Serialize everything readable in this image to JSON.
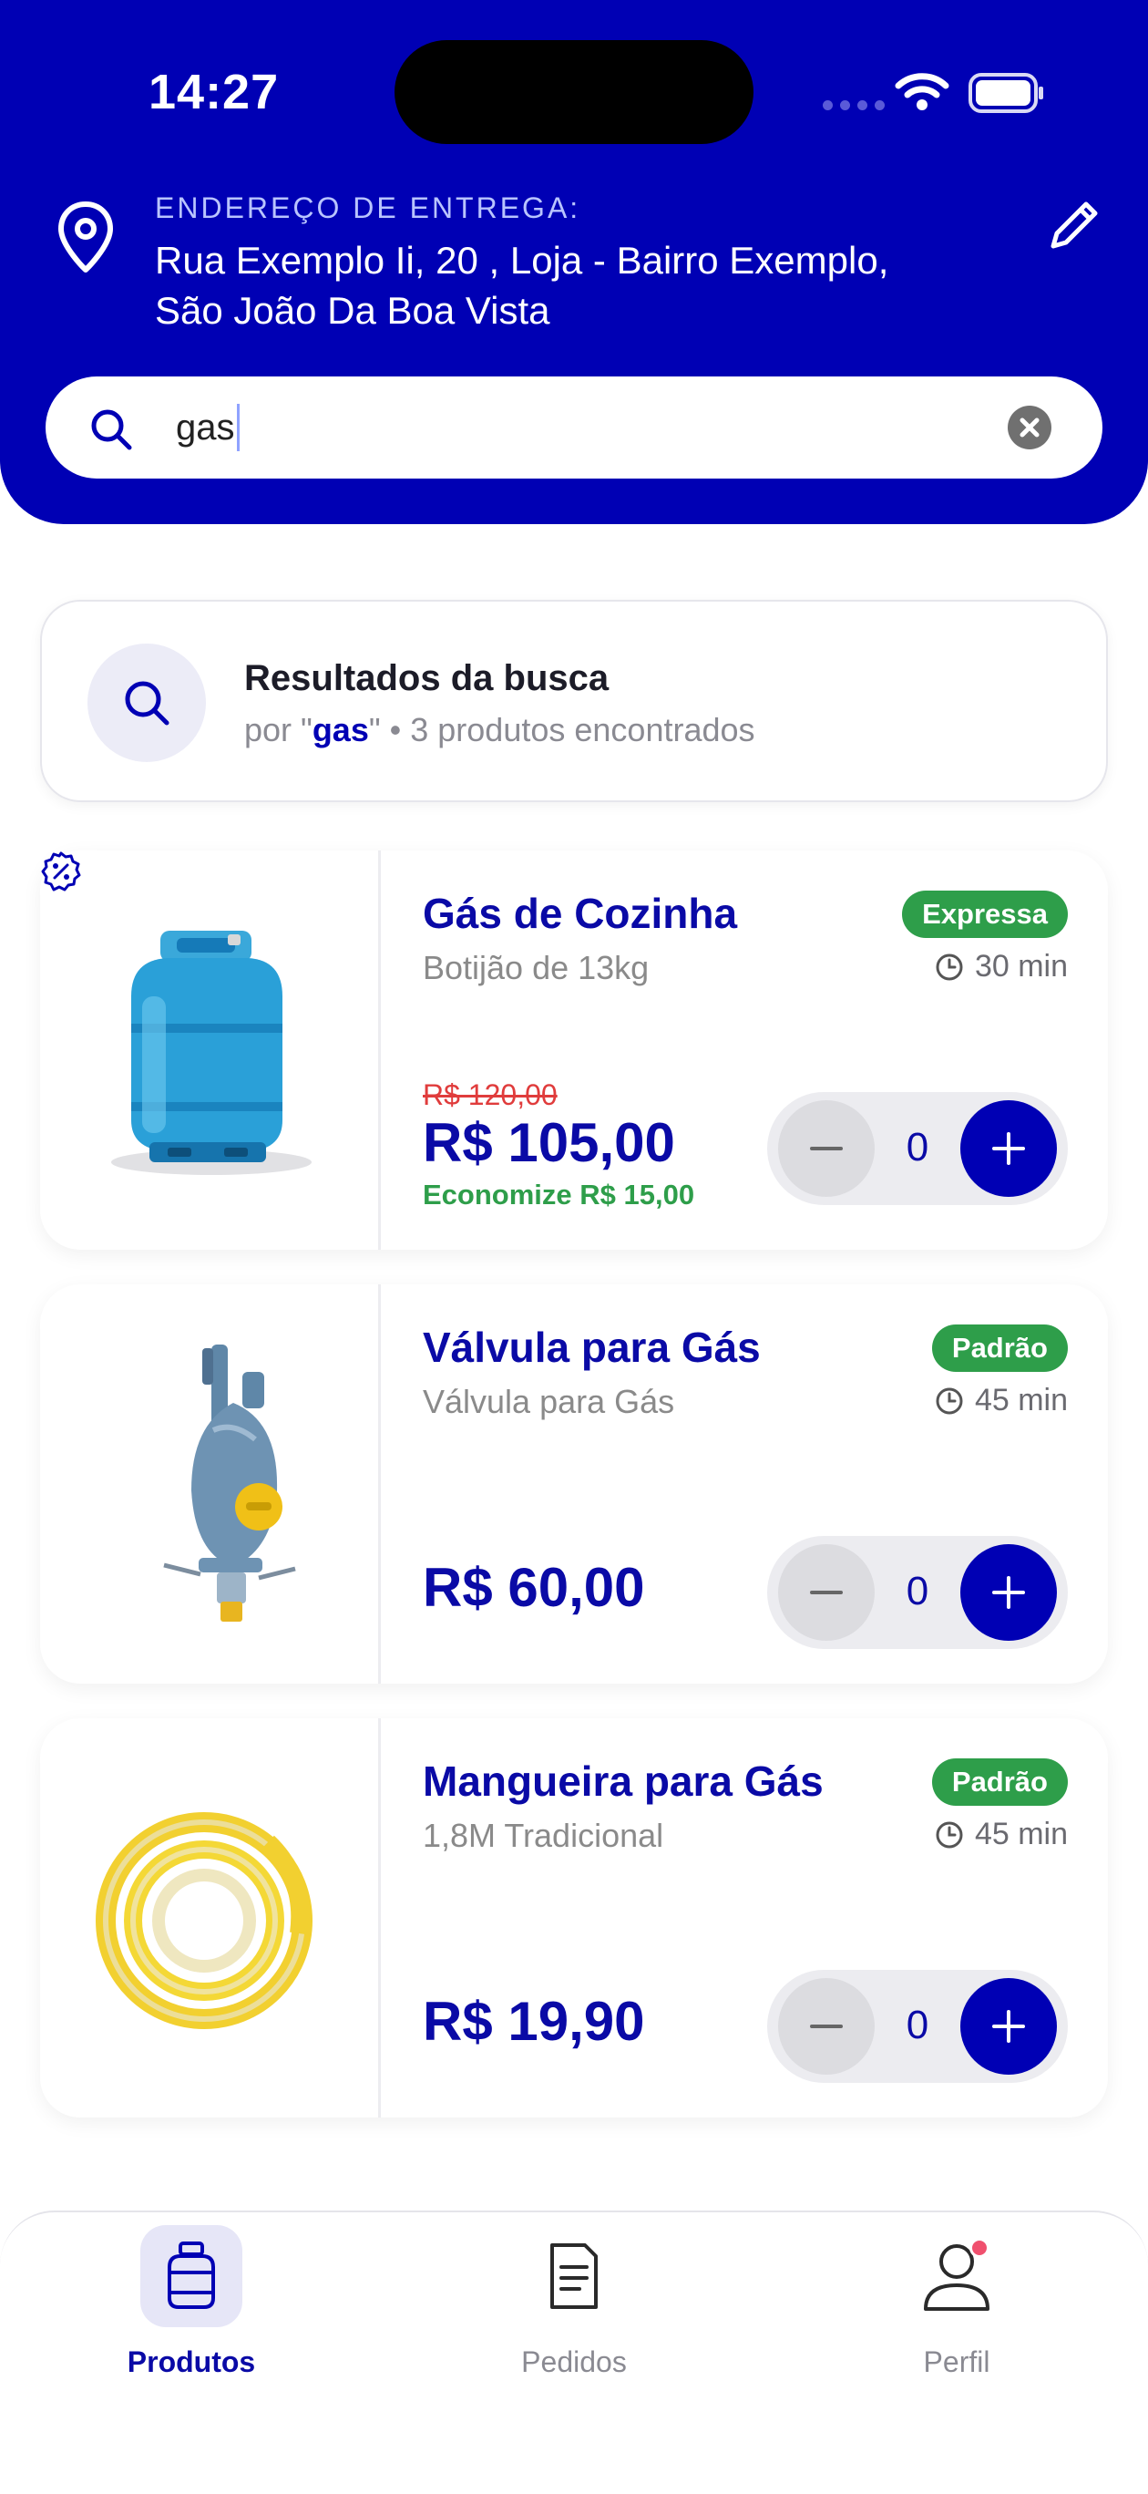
{
  "status_bar": {
    "time": "14:27"
  },
  "address": {
    "label": "ENDEREÇO DE ENTREGA:",
    "line1": "Rua Exemplo Ii, 20 , Loja - Bairro Exemplo,",
    "line2": "São João Da Boa Vista"
  },
  "search": {
    "value": "gas",
    "icon": "search-icon",
    "clear_icon": "clear-icon"
  },
  "results": {
    "title": "Resultados da busca",
    "by": "por \"",
    "query": "gas",
    "close_quote": "\"",
    "separator": " • ",
    "count_text": "3 produtos encontrados"
  },
  "products": [
    {
      "name": "Gás de Cozinha",
      "description": "Botijão de 13kg",
      "badge": "Expressa",
      "time": "30 min",
      "old_price": "R$ 120,00",
      "price": "R$ 105,00",
      "savings": "Economize R$ 15,00",
      "quantity": "0"
    },
    {
      "name": "Válvula para Gás",
      "description": "Válvula para Gás",
      "badge": "Padrão",
      "time": "45 min",
      "price": "R$ 60,00",
      "quantity": "0"
    },
    {
      "name": "Mangueira para Gás",
      "description": "1,8M Tradicional",
      "badge": "Padrão",
      "time": "45 min",
      "price": "R$ 19,90",
      "quantity": "0"
    }
  ],
  "nav": {
    "items": [
      {
        "label": "Produtos",
        "icon": "gas-cylinder-icon",
        "active": true
      },
      {
        "label": "Pedidos",
        "icon": "document-icon",
        "active": false
      },
      {
        "label": "Perfil",
        "icon": "user-icon",
        "active": false
      }
    ]
  },
  "colors": {
    "primary": "#0000b4",
    "badge_green": "#2e9e4a",
    "old_price_red": "#e03c3c",
    "notification": "#f0506e"
  }
}
